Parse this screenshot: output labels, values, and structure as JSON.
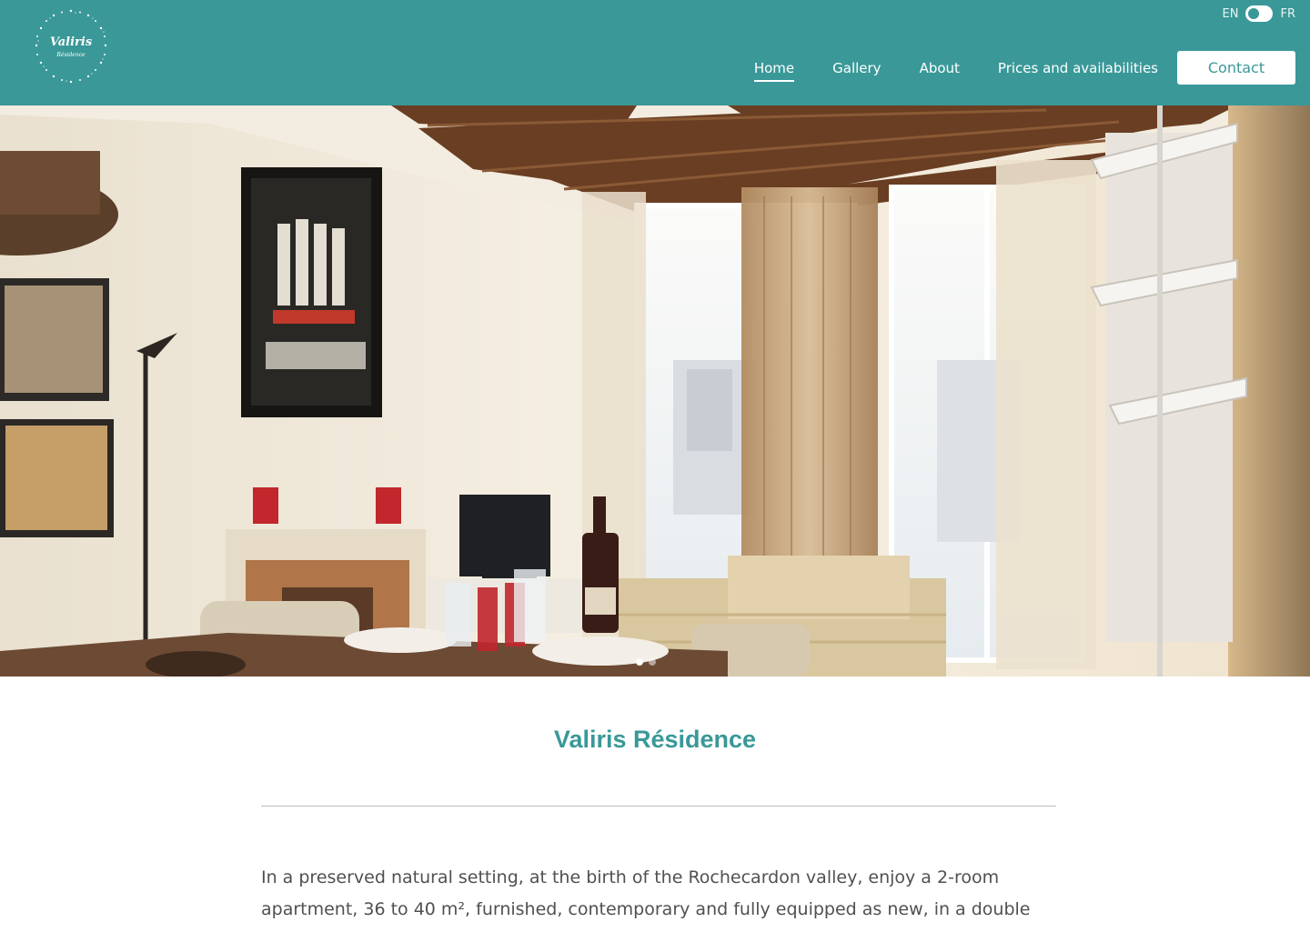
{
  "header": {
    "logo": {
      "name": "Valiris",
      "subtitle": "Résidence"
    },
    "language": {
      "left": "EN",
      "right": "FR",
      "selected": "EN"
    },
    "nav": [
      {
        "label": "Home",
        "active": true
      },
      {
        "label": "Gallery",
        "active": false
      },
      {
        "label": "About",
        "active": false
      },
      {
        "label": "Prices and availabilities",
        "active": false
      }
    ],
    "contact_label": "Contact"
  },
  "hero": {
    "image": "apartment-living-room-photo",
    "slides_count": 2,
    "active_slide": 1
  },
  "main": {
    "title": "Valiris Résidence",
    "intro": "In a preserved natural setting, at the birth of the Rochecardon valley, enjoy a 2-room apartment, 36 to 40 m², furnished, contemporary and fully equipped as new, in a double"
  },
  "colors": {
    "brand": "#3a9898",
    "text": "#505050",
    "background": "#ffffff"
  }
}
